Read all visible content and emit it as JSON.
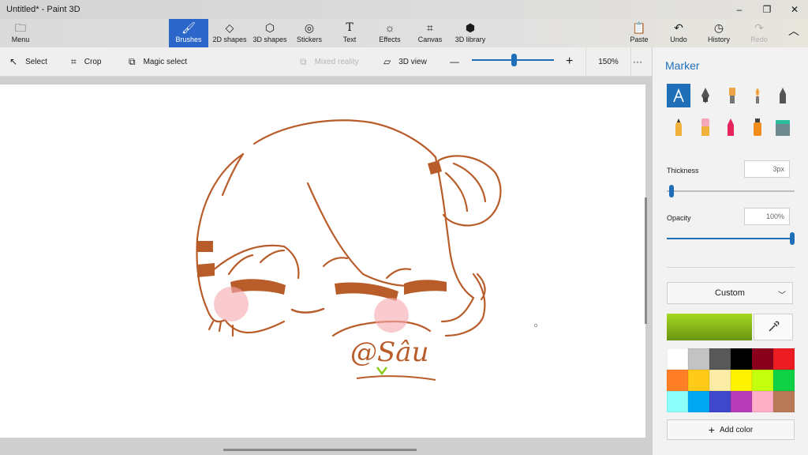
{
  "window": {
    "title": "Untitled* - Paint 3D",
    "minimize": "–",
    "maximize": "❐",
    "close": "✕"
  },
  "ribbon": {
    "menu": "Menu",
    "tabs": [
      "Brushes",
      "2D shapes",
      "3D shapes",
      "Stickers",
      "Text",
      "Effects",
      "Canvas",
      "3D library"
    ],
    "active_tab": "Brushes",
    "actions": [
      "Paste",
      "Undo",
      "History",
      "Redo"
    ]
  },
  "toolbar": {
    "select": "Select",
    "crop": "Crop",
    "magic_select": "Magic select",
    "mixed_reality": "Mixed reality",
    "view_3d": "3D view",
    "zoom_minus": "—",
    "zoom_plus": "+",
    "zoom_level": "150%",
    "more": "···",
    "zoom_fraction": 0.5
  },
  "canvas": {
    "signature": "@Sâu"
  },
  "panel": {
    "title": "Marker",
    "thickness_label": "Thickness",
    "thickness_value": "3px",
    "thickness_fraction": 0.03,
    "opacity_label": "Opacity",
    "opacity_value": "100%",
    "opacity_fraction": 1.0,
    "dropdown_value": "Custom",
    "current_color": "#a4d81f",
    "palette": [
      "#ffffff",
      "#c3c3c3",
      "#585858",
      "#000000",
      "#88001b",
      "#ec1c24",
      "#ff7f27",
      "#ffca18",
      "#fdeca6",
      "#fff200",
      "#c4ff0e",
      "#0ed145",
      "#8cfffb",
      "#00a8f3",
      "#3f48cc",
      "#b83dba",
      "#ffaec8",
      "#b97a57"
    ],
    "add_color": "Add color"
  },
  "colors": {
    "accent": "#1f6fb8",
    "active_tab": "#2b66c8",
    "drawing": "#b85c2a"
  }
}
